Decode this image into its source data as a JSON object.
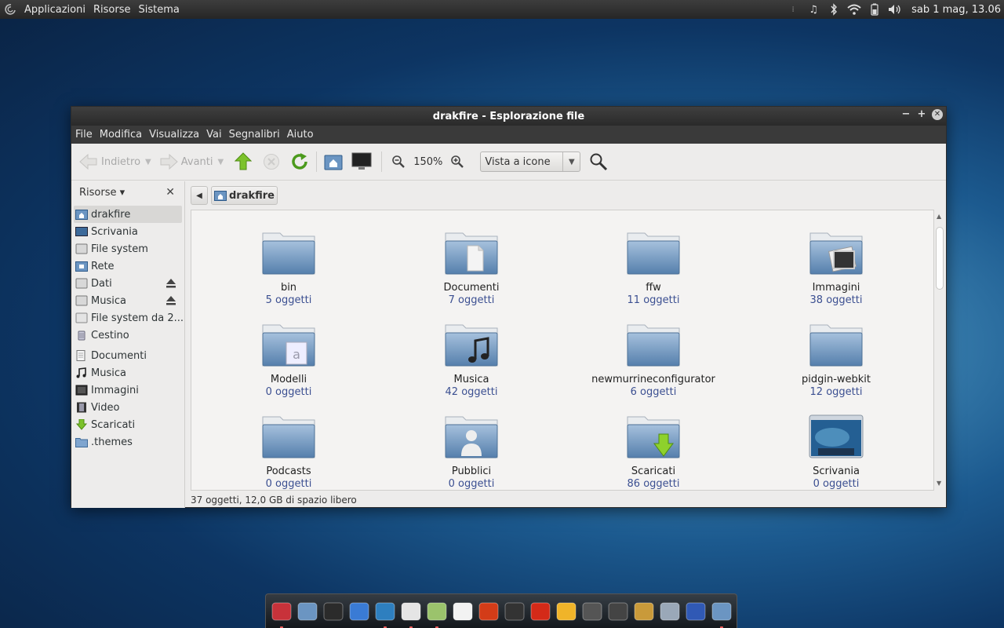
{
  "top_panel": {
    "menus": [
      "Applicazioni",
      "Risorse",
      "Sistema"
    ],
    "clock": "sab  1 mag, 13.06"
  },
  "window": {
    "title": "drakfire - Esplorazione file",
    "menubar": [
      "File",
      "Modifica",
      "Visualizza",
      "Vai",
      "Segnalibri",
      "Aiuto"
    ],
    "toolbar": {
      "back_label": "Indietro",
      "forward_label": "Avanti",
      "zoom_level": "150%",
      "view_mode": "Vista a icone"
    },
    "sidebar": {
      "header": "Risorse ▾",
      "places": [
        {
          "label": "drakfire",
          "icon": "home-folder-icon"
        },
        {
          "label": "Scrivania",
          "icon": "desktop-icon"
        },
        {
          "label": "File system",
          "icon": "drive-icon"
        },
        {
          "label": "Rete",
          "icon": "network-icon"
        },
        {
          "label": "Dati",
          "icon": "drive-icon"
        },
        {
          "label": "Musica",
          "icon": "drive-icon"
        },
        {
          "label": "File system da 2...",
          "icon": "drive-icon"
        },
        {
          "label": "Cestino",
          "icon": "trash-icon"
        }
      ],
      "bookmarks": [
        {
          "label": "Documenti",
          "icon": "documents-icon"
        },
        {
          "label": "Musica",
          "icon": "music-icon"
        },
        {
          "label": "Immagini",
          "icon": "pictures-icon"
        },
        {
          "label": "Video",
          "icon": "video-icon"
        },
        {
          "label": "Scaricati",
          "icon": "download-icon"
        },
        {
          "label": ".themes",
          "icon": "folder-icon"
        }
      ]
    },
    "pathbar": {
      "crumb": "drakfire"
    },
    "files": [
      {
        "name": "bin",
        "count": "5 oggetti",
        "emblem": "none"
      },
      {
        "name": "Documenti",
        "count": "7 oggetti",
        "emblem": "document"
      },
      {
        "name": "ffw",
        "count": "11 oggetti",
        "emblem": "none"
      },
      {
        "name": "Immagini",
        "count": "38 oggetti",
        "emblem": "picture"
      },
      {
        "name": "Modelli",
        "count": "0 oggetti",
        "emblem": "template"
      },
      {
        "name": "Musica",
        "count": "42 oggetti",
        "emblem": "music"
      },
      {
        "name": "newmurrineconfigurator",
        "count": "6 oggetti",
        "emblem": "none"
      },
      {
        "name": "pidgin-webkit",
        "count": "12 oggetti",
        "emblem": "none"
      },
      {
        "name": "Podcasts",
        "count": "0 oggetti",
        "emblem": "none"
      },
      {
        "name": "Pubblici",
        "count": "0 oggetti",
        "emblem": "user"
      },
      {
        "name": "Scaricati",
        "count": "86 oggetti",
        "emblem": "download"
      },
      {
        "name": "Scrivania",
        "count": "0 oggetti",
        "emblem": "desktop"
      }
    ],
    "status": "37 oggetti, 12,0 GB di spazio libero"
  },
  "dock": {
    "items": [
      "anchor-icon",
      "home-folder-icon",
      "terminal-icon",
      "email-icon",
      "browser-icon",
      "text-editor-icon",
      "image-viewer-icon",
      "notes-icon",
      "game-icon",
      "system-monitor-icon",
      "firefox-icon",
      "media-player-icon",
      "speaker-icon",
      "video-editor-icon",
      "archive-icon",
      "compass-icon",
      "globe-icon",
      "file-manager-icon"
    ]
  }
}
